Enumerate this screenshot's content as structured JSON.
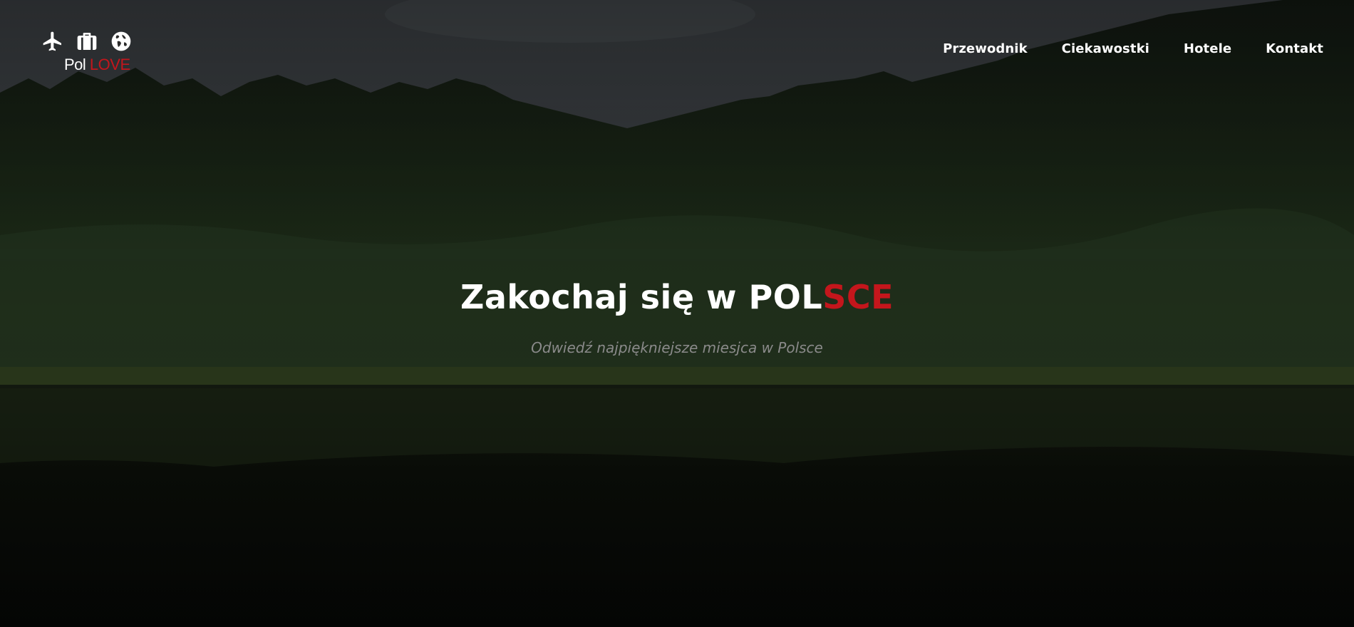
{
  "colors": {
    "accent": "#c4161c",
    "text": "#ffffff",
    "subtle": "#8a8a8a"
  },
  "logo": {
    "icons": [
      "airplane-icon",
      "suitcase-icon",
      "globe-icon"
    ],
    "text_part1": "Pol",
    "text_part2": "LOVE"
  },
  "nav": {
    "items": [
      {
        "label": "Przewodnik"
      },
      {
        "label": "Ciekawostki"
      },
      {
        "label": "Hotele"
      },
      {
        "label": "Kontakt"
      }
    ]
  },
  "hero": {
    "title_part1": "Zakochaj się w POL",
    "title_part2": "SCE",
    "subtitle": "Odwiedź najpiękniejsze miesjca w Polsce"
  }
}
